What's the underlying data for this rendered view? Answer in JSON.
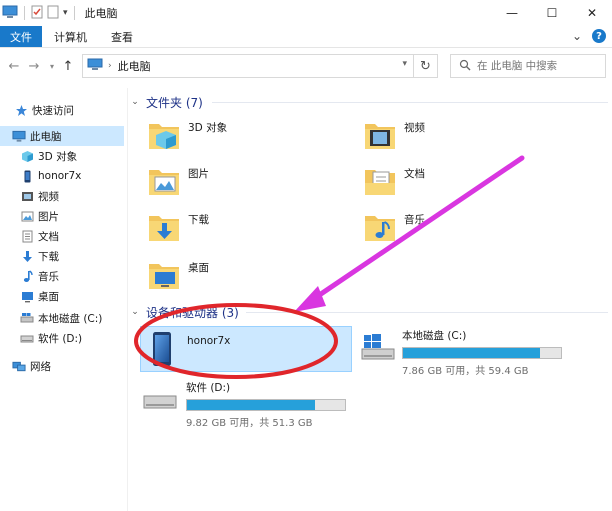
{
  "window": {
    "title": "此电脑",
    "minimize_glyph": "—",
    "maximize_glyph": "☐",
    "close_glyph": "✕"
  },
  "ribbon": {
    "tabs": [
      "文件",
      "计算机",
      "查看"
    ],
    "expand_glyph": "⌄",
    "help_glyph": "?"
  },
  "address": {
    "crumb": "此电脑",
    "search_placeholder": "在 此电脑 中搜索"
  },
  "sidebar": {
    "items": [
      {
        "label": "快速访问",
        "icon": "star-icon"
      },
      {
        "label": "此电脑",
        "icon": "computer-icon",
        "selected": true
      },
      {
        "label": "3D 对象",
        "icon": "cube-icon"
      },
      {
        "label": "honor7x",
        "icon": "phone-icon"
      },
      {
        "label": "视频",
        "icon": "video-icon"
      },
      {
        "label": "图片",
        "icon": "pictures-icon"
      },
      {
        "label": "文档",
        "icon": "document-icon"
      },
      {
        "label": "下载",
        "icon": "download-icon"
      },
      {
        "label": "音乐",
        "icon": "music-icon"
      },
      {
        "label": "桌面",
        "icon": "desktop-icon"
      },
      {
        "label": "本地磁盘 (C:)",
        "icon": "drive-icon"
      },
      {
        "label": "软件 (D:)",
        "icon": "drive-icon"
      },
      {
        "label": "网络",
        "icon": "network-icon"
      }
    ]
  },
  "folders_group": {
    "title": "文件夹 (7)",
    "items": [
      {
        "label": "3D 对象",
        "icon": "cube-folder-icon"
      },
      {
        "label": "视频",
        "icon": "video-folder-icon"
      },
      {
        "label": "图片",
        "icon": "pictures-folder-icon"
      },
      {
        "label": "文档",
        "icon": "documents-folder-icon"
      },
      {
        "label": "下载",
        "icon": "downloads-folder-icon"
      },
      {
        "label": "音乐",
        "icon": "music-folder-icon"
      },
      {
        "label": "桌面",
        "icon": "desktop-folder-icon"
      }
    ]
  },
  "devices_group": {
    "title": "设备和驱动器 (3)",
    "items": [
      {
        "label": "honor7x",
        "icon": "phone-icon",
        "selected": true
      },
      {
        "label": "本地磁盘 (C:)",
        "icon": "windows-drive-icon",
        "usage": "7.86 GB 可用，共 59.4 GB",
        "used_fraction": 0.868
      },
      {
        "label": "软件 (D:)",
        "icon": "drive-icon",
        "usage": "9.82 GB 可用，共 51.3 GB",
        "used_fraction": 0.809
      }
    ]
  },
  "colors": {
    "accent": "#1979ca",
    "selection": "#cce8ff",
    "group_title": "#1e3287",
    "bar_fill": "#26a0da",
    "annotation_red": "#e0262b",
    "annotation_magenta": "#d936e0"
  }
}
